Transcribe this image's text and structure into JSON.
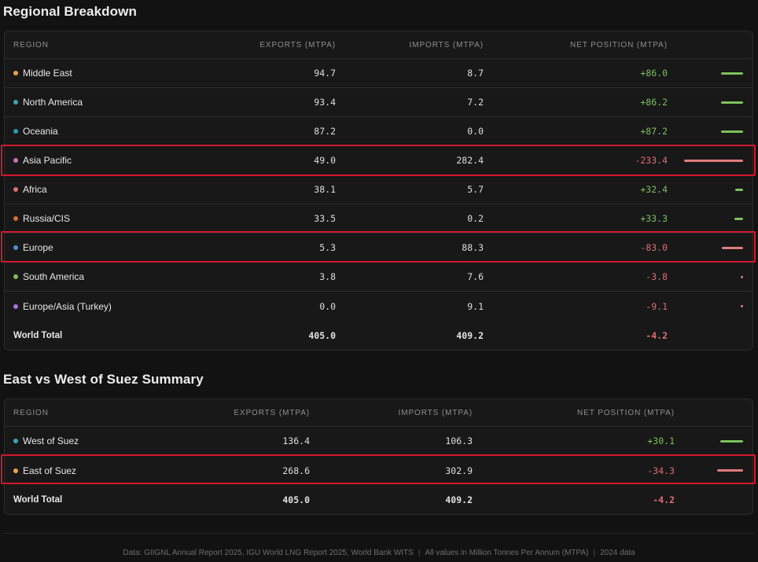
{
  "regional": {
    "title": "Regional Breakdown",
    "headers": {
      "region": "REGION",
      "exports": "EXPORTS (MTPA)",
      "imports": "IMPORTS (MTPA)",
      "net": "NET POSITION (MTPA)"
    },
    "rows": [
      {
        "name": "Middle East",
        "dot": "#f0a04b",
        "exports": "94.7",
        "imports": "8.7",
        "net": "+86.0",
        "net_value": 86.0
      },
      {
        "name": "North America",
        "dot": "#3aa6b9",
        "exports": "93.4",
        "imports": "7.2",
        "net": "+86.2",
        "net_value": 86.2
      },
      {
        "name": "Oceania",
        "dot": "#2a9bb5",
        "exports": "87.2",
        "imports": "0.0",
        "net": "+87.2",
        "net_value": 87.2
      },
      {
        "name": "Asia Pacific",
        "dot": "#d16fb8",
        "exports": "49.0",
        "imports": "282.4",
        "net": "-233.4",
        "net_value": -233.4
      },
      {
        "name": "Africa",
        "dot": "#e06c75",
        "exports": "38.1",
        "imports": "5.7",
        "net": "+32.4",
        "net_value": 32.4
      },
      {
        "name": "Russia/CIS",
        "dot": "#d9702e",
        "exports": "33.5",
        "imports": "0.2",
        "net": "+33.3",
        "net_value": 33.3
      },
      {
        "name": "Europe",
        "dot": "#4f8fd6",
        "exports": "5.3",
        "imports": "88.3",
        "net": "-83.0",
        "net_value": -83.0
      },
      {
        "name": "South America",
        "dot": "#7cc15a",
        "exports": "3.8",
        "imports": "7.6",
        "net": "-3.8",
        "net_value": -3.8
      },
      {
        "name": "Europe/Asia (Turkey)",
        "dot": "#a970e0",
        "exports": "0.0",
        "imports": "9.1",
        "net": "-9.1",
        "net_value": -9.1
      }
    ],
    "total": {
      "name": "World Total",
      "exports": "405.0",
      "imports": "409.2",
      "net": "-4.2"
    }
  },
  "suez": {
    "title": "East vs West of Suez Summary",
    "headers": {
      "region": "REGION",
      "exports": "EXPORTS (MTPA)",
      "imports": "IMPORTS (MTPA)",
      "net": "NET POSITION (MTPA)"
    },
    "rows": [
      {
        "name": "West of Suez",
        "dot": "#3aa6b9",
        "exports": "136.4",
        "imports": "106.3",
        "net": "+30.1",
        "net_value": 30.1
      },
      {
        "name": "East of Suez",
        "dot": "#f0a04b",
        "exports": "268.6",
        "imports": "302.9",
        "net": "-34.3",
        "net_value": -34.3
      }
    ],
    "total": {
      "name": "World Total",
      "exports": "405.0",
      "imports": "409.2",
      "net": "-4.2"
    }
  },
  "footer": {
    "sources": "Data: GIIGNL Annual Report 2025, IGU World LNG Report 2025, World Bank WITS",
    "units": "All values in Million Tonnes Per Annum (MTPA)",
    "year": "2024 data",
    "separator": "|"
  },
  "colors": {
    "positive": "#7cc15a",
    "negative": "#e06c75",
    "highlight": "#d3182f"
  }
}
